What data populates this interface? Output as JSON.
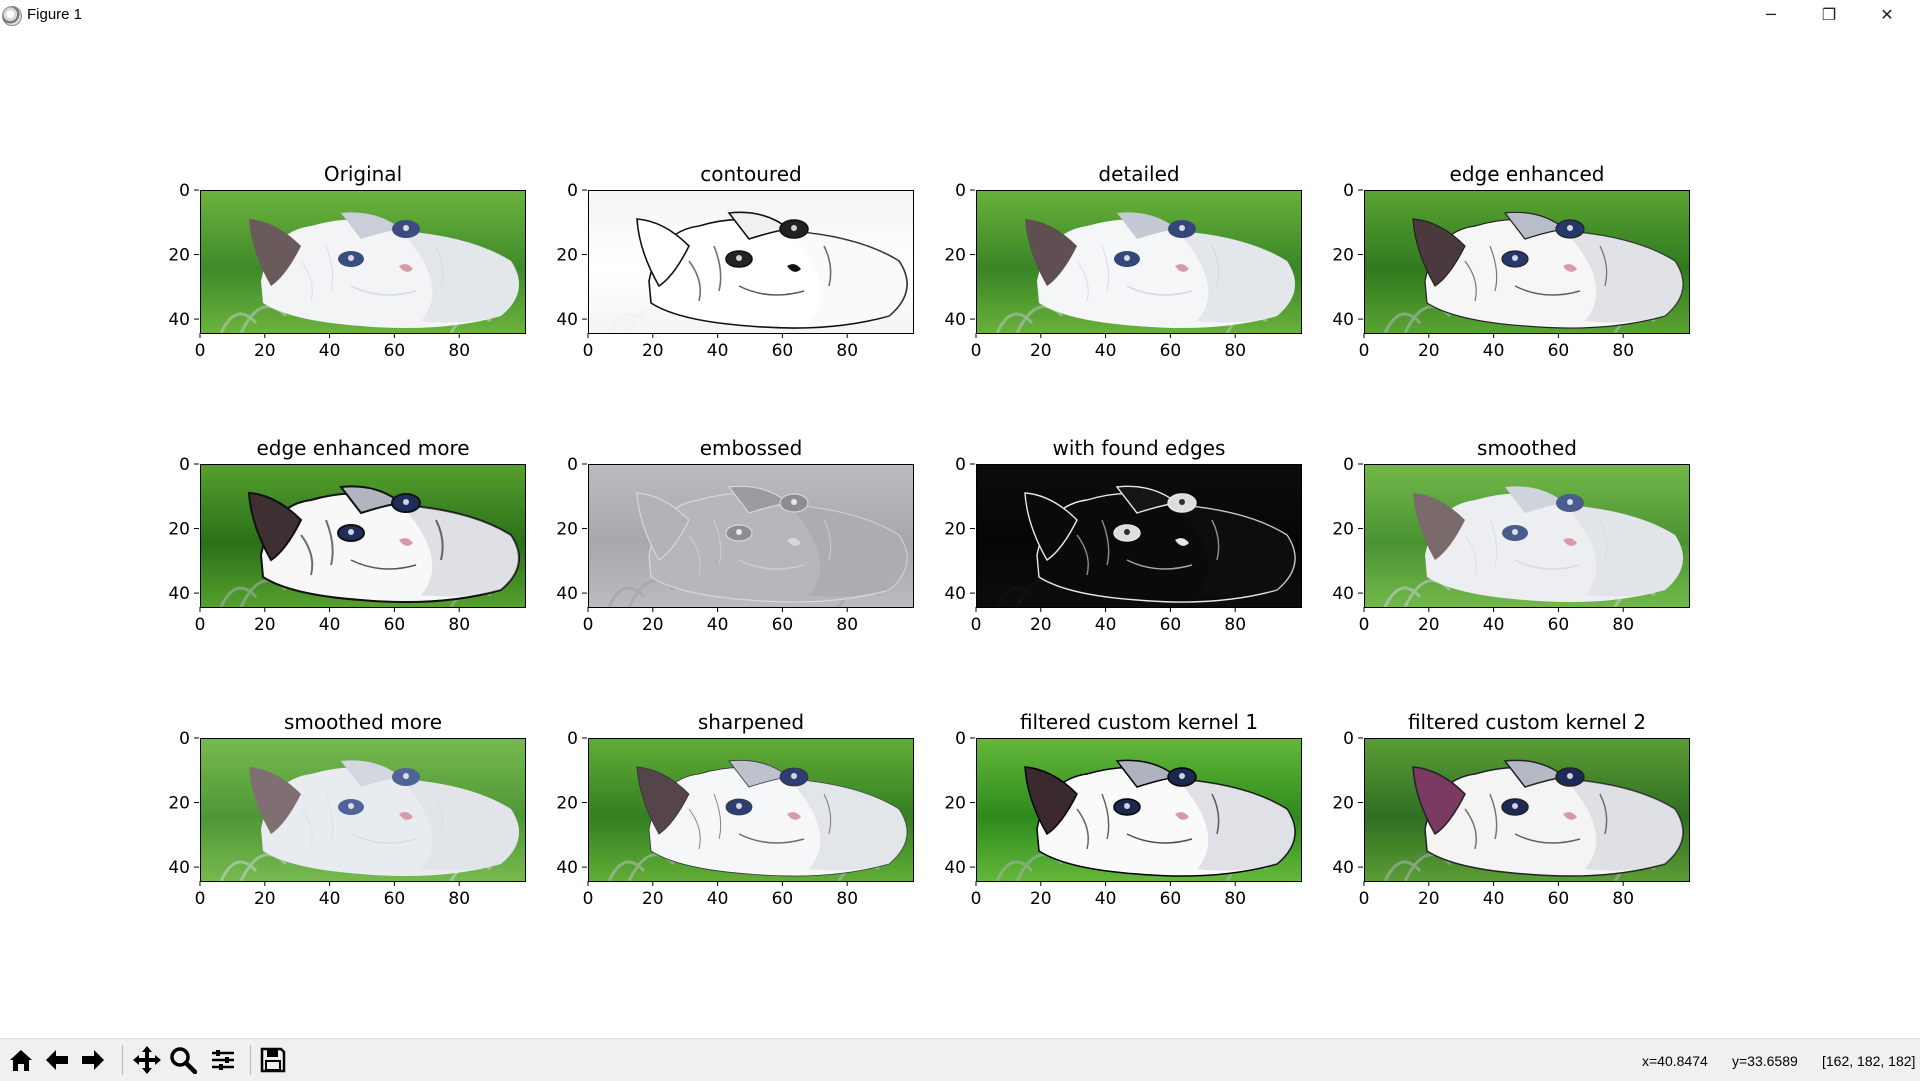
{
  "window": {
    "title": "Figure 1",
    "minimize_glyph": "─",
    "restore_glyph": "❐",
    "close_glyph": "✕"
  },
  "panels": [
    {
      "title": "Original",
      "variant": "original"
    },
    {
      "title": "contoured",
      "variant": "contoured"
    },
    {
      "title": "detailed",
      "variant": "detailed"
    },
    {
      "title": "edge enhanced",
      "variant": "edge"
    },
    {
      "title": "edge enhanced more",
      "variant": "edgemore"
    },
    {
      "title": "embossed",
      "variant": "emboss"
    },
    {
      "title": "with found edges",
      "variant": "findedges"
    },
    {
      "title": "smoothed",
      "variant": "smooth"
    },
    {
      "title": "smoothed more",
      "variant": "smoothmore"
    },
    {
      "title": "sharpened",
      "variant": "sharpen"
    },
    {
      "title": "filtered custom kernel 1",
      "variant": "custom1"
    },
    {
      "title": "filtered custom kernel 2",
      "variant": "custom2"
    }
  ],
  "axes": {
    "xticks": [
      "0",
      "20",
      "40",
      "60",
      "80"
    ],
    "yticks": [
      "0",
      "20",
      "40"
    ],
    "xlim": [
      0,
      100
    ],
    "ylim": [
      0,
      44
    ]
  },
  "toolbar": {
    "buttons": [
      "home-icon",
      "back-icon",
      "forward-icon",
      "pan-icon",
      "zoom-icon",
      "configure-subplots-icon",
      "save-icon"
    ]
  },
  "status": {
    "x": "x=40.8474",
    "y": "y=33.6589",
    "pixel": "[162, 182, 182]"
  }
}
